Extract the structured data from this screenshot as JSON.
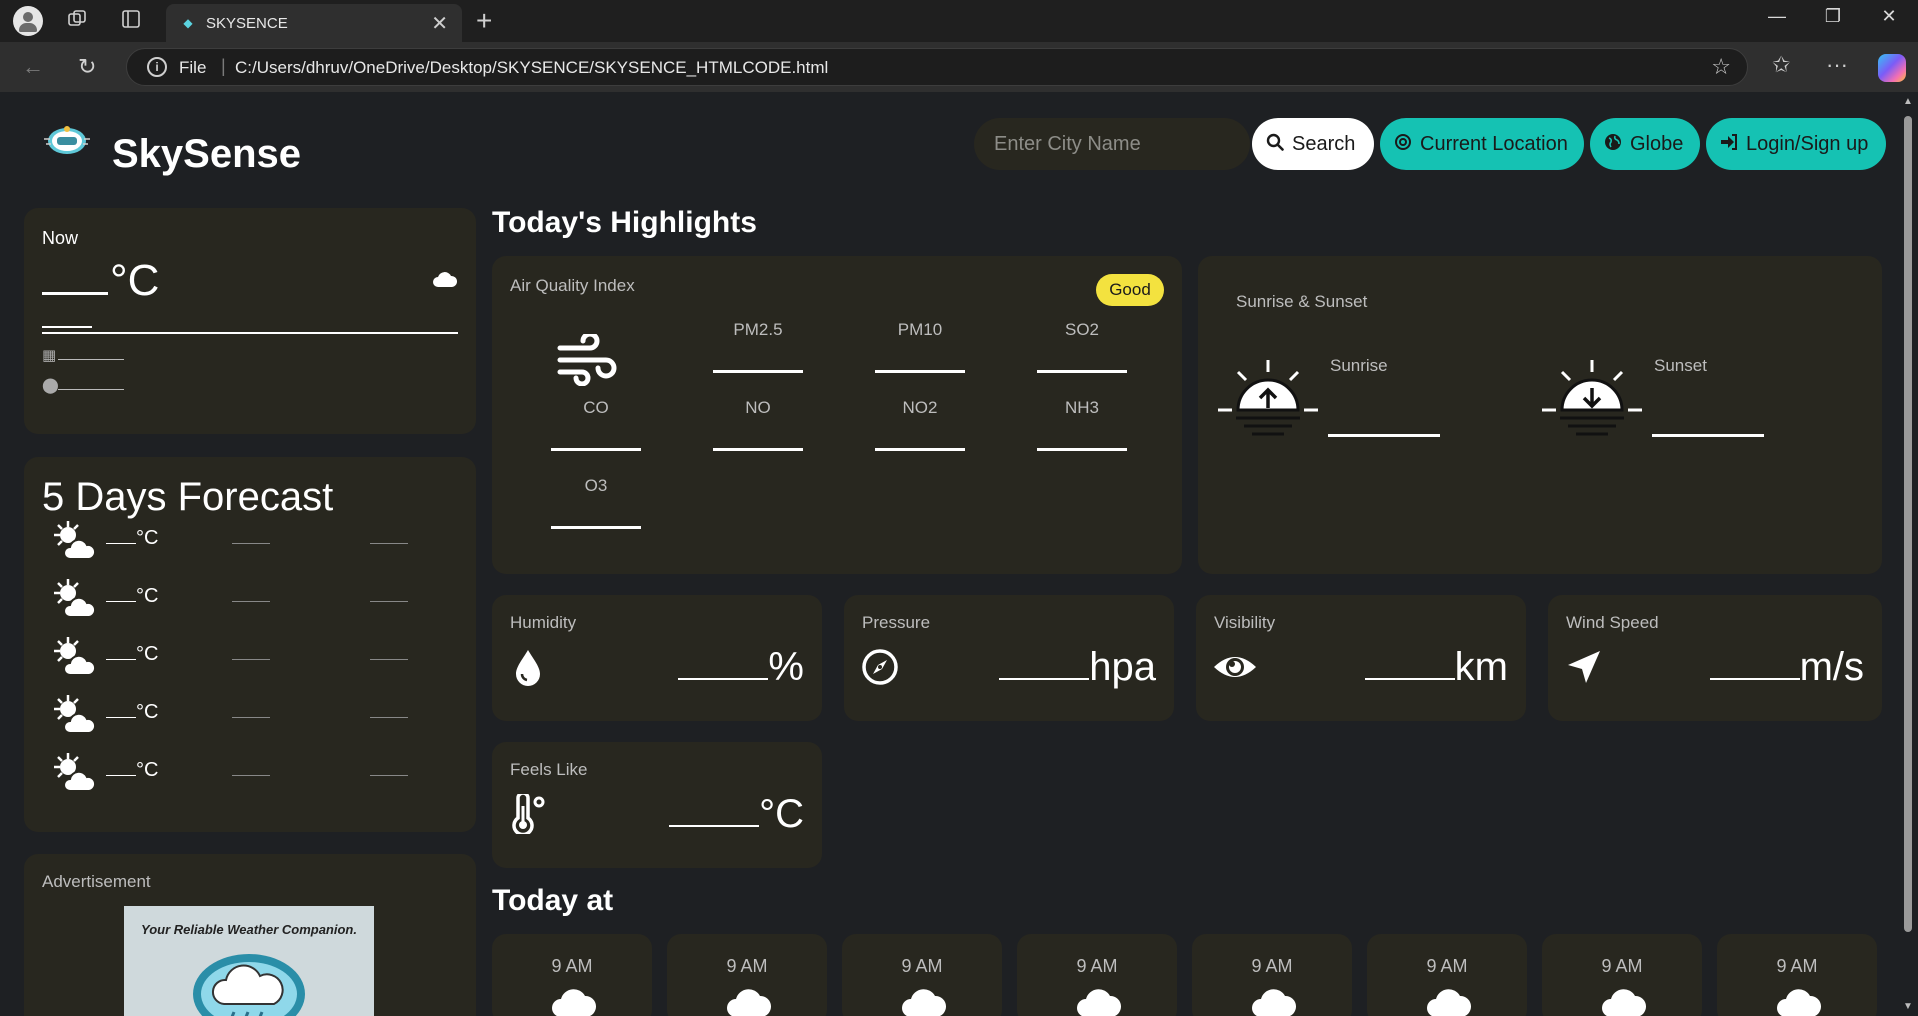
{
  "browser": {
    "tab_title": "SKYSENCE",
    "url_scheme": "File",
    "url": "C:/Users/dhruv/OneDrive/Desktop/SKYSENCE/SKYSENCE_HTMLCODE.html"
  },
  "header": {
    "brand": "SkySense",
    "search_placeholder": "Enter City Name",
    "search_label": "Search",
    "current_location_label": "Current Location",
    "globe_label": "Globe",
    "login_label": "Login/Sign up"
  },
  "now": {
    "label": "Now",
    "temp_unit": "°C"
  },
  "forecast": {
    "title": "5 Days Forecast",
    "rows": [
      {
        "unit": "°C"
      },
      {
        "unit": "°C"
      },
      {
        "unit": "°C"
      },
      {
        "unit": "°C"
      },
      {
        "unit": "°C"
      }
    ]
  },
  "advertisement": {
    "label": "Advertisement",
    "tagline": "Your Reliable Weather Companion."
  },
  "highlights": {
    "title": "Today's Highlights",
    "aqi": {
      "label": "Air Quality Index",
      "badge": "Good",
      "pollutants": [
        "PM2.5",
        "PM10",
        "SO2",
        "CO",
        "NO",
        "NO2",
        "NH3",
        "O3"
      ]
    },
    "sun": {
      "label": "Sunrise & Sunset",
      "sunrise": "Sunrise",
      "sunset": "Sunset"
    },
    "humidity": {
      "label": "Humidity",
      "unit": "%"
    },
    "pressure": {
      "label": "Pressure",
      "unit": "hpa"
    },
    "visibility": {
      "label": "Visibility",
      "unit": "km"
    },
    "wind": {
      "label": "Wind Speed",
      "unit": "m/s"
    },
    "feels": {
      "label": "Feels Like",
      "unit": "°C"
    }
  },
  "today": {
    "title": "Today at",
    "hours": [
      "9 AM",
      "9 AM",
      "9 AM",
      "9 AM",
      "9 AM",
      "9 AM",
      "9 AM",
      "9 AM"
    ]
  }
}
